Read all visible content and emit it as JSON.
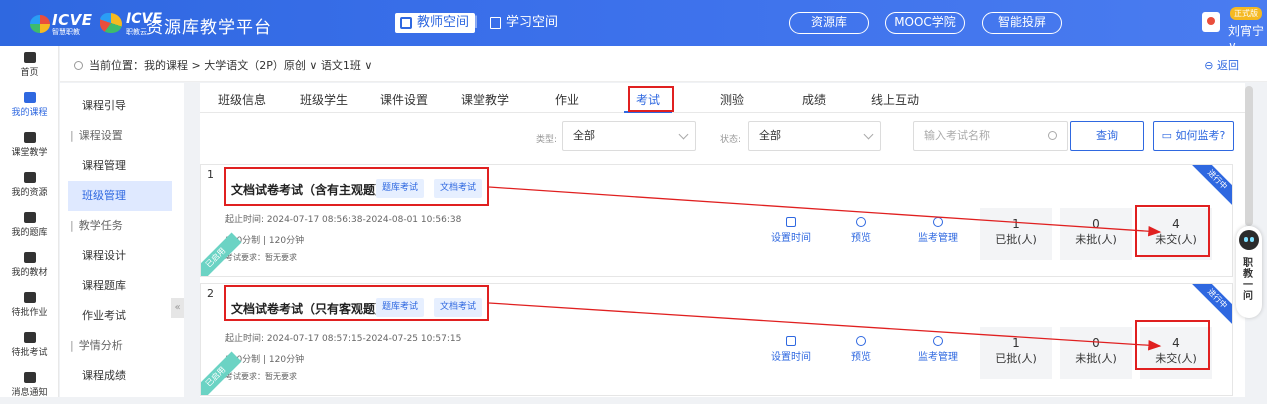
{
  "header": {
    "logo1_text": "ICVE",
    "logo1_sub": "智慧职教",
    "logo2_text": "ICVE",
    "logo2_sub": "职教云",
    "site_title": "资源库教学平台",
    "space_teacher": "教师空间",
    "separator": "|",
    "space_study": "学习空间",
    "pills": [
      "资源库",
      "MOOC学院",
      "智能投屏"
    ],
    "user_badge": "正式版",
    "user_name": "刘宵宁 ∨"
  },
  "leftnav": [
    {
      "label": "首页",
      "icon": "home-icon"
    },
    {
      "label": "我的课程",
      "icon": "book-icon",
      "active": true
    },
    {
      "label": "课堂教学",
      "icon": "play-icon"
    },
    {
      "label": "我的资源",
      "icon": "folder-icon"
    },
    {
      "label": "我的题库",
      "icon": "question-bank-icon"
    },
    {
      "label": "我的教材",
      "icon": "textbook-icon"
    },
    {
      "label": "待批作业",
      "icon": "homework-icon"
    },
    {
      "label": "待批考试",
      "icon": "exam-icon"
    },
    {
      "label": "消息通知",
      "icon": "message-icon"
    }
  ],
  "breadcrumb": {
    "text": "当前位置：我的课程 > 大学语文（2P）原创 ∨  语文1班 ∨",
    "back": "返回"
  },
  "sidemenu": [
    {
      "label": "课程引导",
      "type": "item"
    },
    {
      "label": "课程设置",
      "type": "group"
    },
    {
      "label": "课程管理",
      "type": "item"
    },
    {
      "label": "班级管理",
      "type": "item",
      "active": true
    },
    {
      "label": "教学任务",
      "type": "group"
    },
    {
      "label": "课程设计",
      "type": "item"
    },
    {
      "label": "课程题库",
      "type": "item"
    },
    {
      "label": "作业考试",
      "type": "item"
    },
    {
      "label": "学情分析",
      "type": "group"
    },
    {
      "label": "课程成绩",
      "type": "item"
    }
  ],
  "tabs": [
    "班级信息",
    "班级学生",
    "课件设置",
    "课堂教学",
    "作业",
    "考试",
    "测验",
    "成绩",
    "线上互动"
  ],
  "active_tab": "考试",
  "filters": {
    "type_label": "类型:",
    "type_value": "全部",
    "status_label": "状态:",
    "status_value": "全部",
    "search_placeholder": "输入考试名称",
    "query_button": "查询",
    "help_button": "如何监考?"
  },
  "exams": [
    {
      "index": "1",
      "title": "文档试卷考试（含有主观题）",
      "tags": [
        "题库考试",
        "文档考试"
      ],
      "time": "起止时间: 2024-07-17 08:56:38-2024-08-01 10:56:38",
      "score": "100分制 | 120分钟",
      "requirement": "考试要求：暂无要求",
      "status_ribbon": "进行中",
      "used_ribbon": "已启用",
      "actions": [
        "设置时间",
        "预览",
        "监考管理"
      ],
      "stats": [
        {
          "n": "1",
          "label": "已批(人)"
        },
        {
          "n": "0",
          "label": "未批(人)"
        },
        {
          "n": "4",
          "label": "未交(人)"
        }
      ]
    },
    {
      "index": "2",
      "title": "文档试卷考试（只有客观题）",
      "tags": [
        "题库考试",
        "文档考试"
      ],
      "time": "起止时间: 2024-07-17 08:57:15-2024-07-25 10:57:15",
      "score": "100分制 | 120分钟",
      "requirement": "考试要求：暂无要求",
      "status_ribbon": "进行中",
      "used_ribbon": "已启用",
      "actions": [
        "设置时间",
        "预览",
        "监考管理"
      ],
      "stats": [
        {
          "n": "1",
          "label": "已批(人)"
        },
        {
          "n": "0",
          "label": "未批(人)"
        },
        {
          "n": "4",
          "label": "未交(人)"
        }
      ]
    }
  ],
  "float_widget": "职教一问",
  "colors": {
    "primary": "#2f68e0",
    "annotation": "#e02020"
  }
}
